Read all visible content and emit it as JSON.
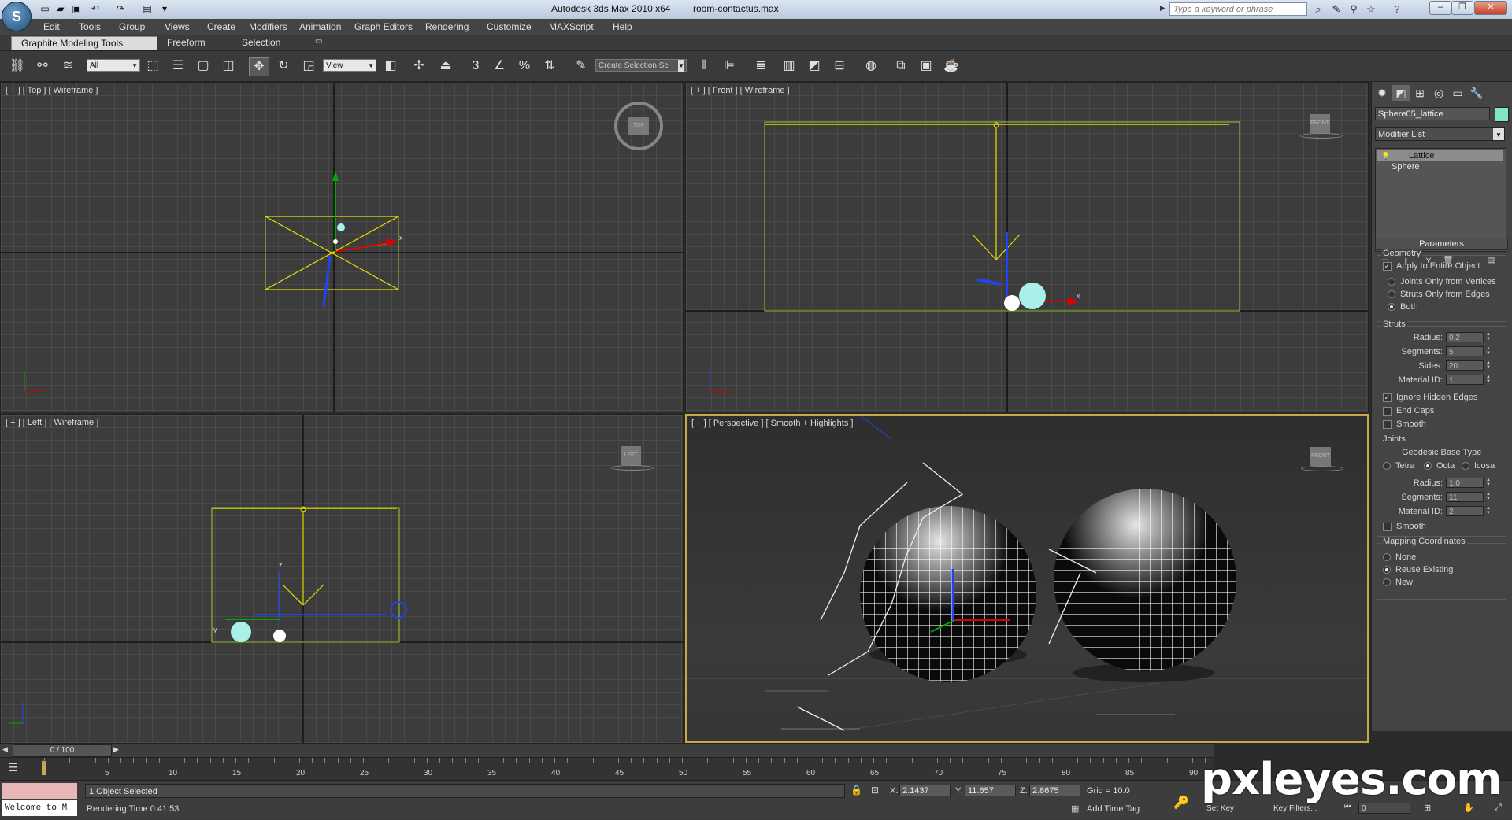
{
  "window": {
    "title": "Autodesk 3ds Max  2010 x64",
    "file": "room-contactus.max",
    "search_placeholder": "Type a keyword or phrase",
    "logo": "S"
  },
  "menu": [
    "Edit",
    "Tools",
    "Group",
    "Views",
    "Create",
    "Modifiers",
    "Animation",
    "Graph Editors",
    "Rendering",
    "Customize",
    "MAXScript",
    "Help"
  ],
  "ribbon": {
    "tabs": [
      "Graphite Modeling Tools",
      "Freeform",
      "Selection"
    ],
    "active": "Graphite Modeling Tools"
  },
  "toolbar": {
    "filter_value": "All",
    "ref_coord_value": "View",
    "named_selection_value": "Create Selection Se"
  },
  "viewports": {
    "top": "[ + ] [ Top ] [ Wireframe ]",
    "front": "[ + ] [ Front ] [ Wireframe ]",
    "left": "[ + ] [ Left ] [ Wireframe ]",
    "persp": "[ + ] [ Perspective ] [ Smooth + Highlights ]",
    "viewcube_top": "TOP",
    "viewcube_front": "FRONT",
    "viewcube_left": "LEFT",
    "axis_x": "x",
    "axis_y": "y",
    "axis_z": "z"
  },
  "command_panel": {
    "object_name": "Sphere05_lattice",
    "object_color": "#7ee8c0",
    "modifier_list": "Modifier List",
    "stack": [
      "Lattice",
      "Sphere"
    ],
    "parameters_title": "Parameters",
    "geometry": {
      "title": "Geometry",
      "apply_entire": "Apply to Entire Object",
      "joints_only": "Joints Only from Vertices",
      "struts_only": "Struts Only from Edges",
      "both": "Both"
    },
    "struts": {
      "title": "Struts",
      "radius_label": "Radius:",
      "radius": "0.2",
      "segments_label": "Segments:",
      "segments": "5",
      "sides_label": "Sides:",
      "sides": "20",
      "material_label": "Material ID:",
      "material": "1",
      "ignore_hidden": "Ignore Hidden Edges",
      "end_caps": "End Caps",
      "smooth": "Smooth"
    },
    "joints": {
      "title": "Joints",
      "geodesic": "Geodesic Base Type",
      "tetra": "Tetra",
      "octa": "Octa",
      "icosa": "Icosa",
      "radius_label": "Radius:",
      "radius": "1.0",
      "segments_label": "Segments:",
      "segments": "11",
      "material_label": "Material ID:",
      "material": "2",
      "smooth": "Smooth"
    },
    "mapping": {
      "title": "Mapping Coordinates",
      "none": "None",
      "reuse": "Reuse Existing",
      "new": "New"
    }
  },
  "timeline": {
    "frame_display": "0 / 100",
    "ticks": [
      "5",
      "10",
      "15",
      "20",
      "25",
      "30",
      "35",
      "40",
      "45",
      "50",
      "55",
      "60",
      "65",
      "70",
      "75",
      "80",
      "85",
      "90"
    ]
  },
  "status": {
    "selection": "1 Object Selected",
    "render_time": "Rendering Time  0:41:53",
    "listener": "Welcome to M",
    "x_label": "X:",
    "x": "2.1437",
    "y_label": "Y:",
    "y": "11.657",
    "z_label": "Z:",
    "z": "2.8675",
    "grid": "Grid = 10.0",
    "add_time_tag": "Add Time Tag",
    "set_key": "Set Key",
    "key_filters": "Key Filters...",
    "frame": "0"
  },
  "watermark": "pxleyes.com"
}
